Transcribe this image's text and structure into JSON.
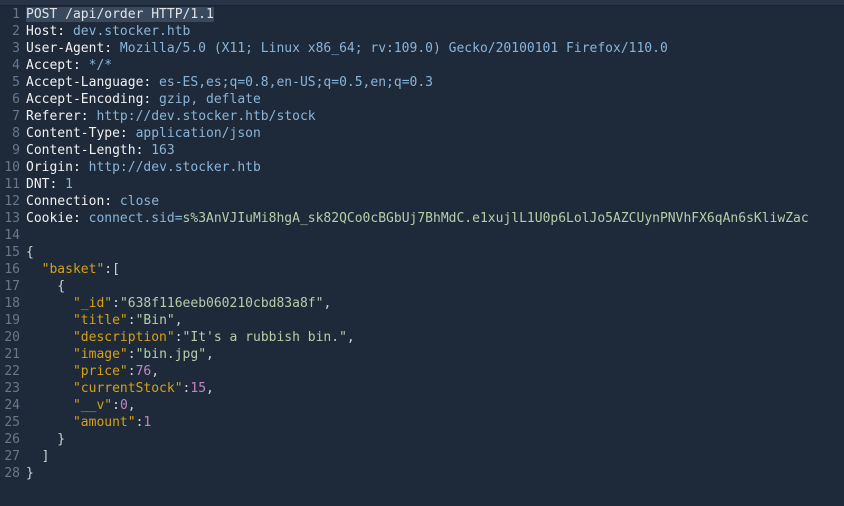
{
  "lines": [
    {
      "n": 1,
      "segs": [
        {
          "t": "POST /api/order HTTP/1.1",
          "c": "sel"
        }
      ]
    },
    {
      "n": 2,
      "segs": [
        {
          "t": "Host:",
          "c": "hdr"
        },
        {
          "t": " dev.stocker.htb",
          "c": "val"
        }
      ]
    },
    {
      "n": 3,
      "segs": [
        {
          "t": "User-Agent:",
          "c": "hdr"
        },
        {
          "t": " Mozilla/5.0 (X11; Linux x86_64; rv:109.0) Gecko/20100101 Firefox/110.0",
          "c": "val"
        }
      ]
    },
    {
      "n": 4,
      "segs": [
        {
          "t": "Accept:",
          "c": "hdr"
        },
        {
          "t": " */*",
          "c": "val"
        }
      ]
    },
    {
      "n": 5,
      "segs": [
        {
          "t": "Accept-Language:",
          "c": "hdr"
        },
        {
          "t": " es-ES,es;q=0.8,en-US;q=0.5,en;q=0.3",
          "c": "val"
        }
      ]
    },
    {
      "n": 6,
      "segs": [
        {
          "t": "Accept-Encoding:",
          "c": "hdr"
        },
        {
          "t": " gzip, deflate",
          "c": "val"
        }
      ]
    },
    {
      "n": 7,
      "segs": [
        {
          "t": "Referer:",
          "c": "hdr"
        },
        {
          "t": " http://dev.stocker.htb/stock",
          "c": "val"
        }
      ]
    },
    {
      "n": 8,
      "segs": [
        {
          "t": "Content-Type:",
          "c": "hdr"
        },
        {
          "t": " application/json",
          "c": "val"
        }
      ]
    },
    {
      "n": 9,
      "segs": [
        {
          "t": "Content-Length:",
          "c": "hdr"
        },
        {
          "t": " 163",
          "c": "val"
        }
      ]
    },
    {
      "n": 10,
      "segs": [
        {
          "t": "Origin:",
          "c": "hdr"
        },
        {
          "t": " http://dev.stocker.htb",
          "c": "val"
        }
      ]
    },
    {
      "n": 11,
      "segs": [
        {
          "t": "DNT:",
          "c": "hdr"
        },
        {
          "t": " 1",
          "c": "val"
        }
      ]
    },
    {
      "n": 12,
      "segs": [
        {
          "t": "Connection:",
          "c": "hdr"
        },
        {
          "t": " close",
          "c": "val"
        }
      ]
    },
    {
      "n": 13,
      "segs": [
        {
          "t": "Cookie:",
          "c": "hdr"
        },
        {
          "t": " connect.sid=",
          "c": "val"
        },
        {
          "t": "s%3AnVJIuMi8hgA_sk82QCo0cBGbUj7BhMdC.e1xujlL1U0p6LolJo5AZCUynPNVhFX6qAn6sKliwZac",
          "c": "str"
        }
      ]
    },
    {
      "n": 14,
      "segs": [
        {
          "t": "",
          "c": "punct"
        }
      ]
    },
    {
      "n": 15,
      "segs": [
        {
          "t": "{",
          "c": "punct"
        }
      ]
    },
    {
      "n": 16,
      "segs": [
        {
          "t": "  ",
          "c": "punct"
        },
        {
          "t": "\"basket\"",
          "c": "key"
        },
        {
          "t": ":[",
          "c": "punct"
        }
      ]
    },
    {
      "n": 17,
      "segs": [
        {
          "t": "    {",
          "c": "punct"
        }
      ]
    },
    {
      "n": 18,
      "segs": [
        {
          "t": "      ",
          "c": "punct"
        },
        {
          "t": "\"_id\"",
          "c": "key"
        },
        {
          "t": ":",
          "c": "punct"
        },
        {
          "t": "\"638f116eeb060210cbd83a8f\"",
          "c": "str"
        },
        {
          "t": ",",
          "c": "punct"
        }
      ]
    },
    {
      "n": 19,
      "segs": [
        {
          "t": "      ",
          "c": "punct"
        },
        {
          "t": "\"title\"",
          "c": "key"
        },
        {
          "t": ":",
          "c": "punct"
        },
        {
          "t": "\"Bin\"",
          "c": "str"
        },
        {
          "t": ",",
          "c": "punct"
        }
      ]
    },
    {
      "n": 20,
      "segs": [
        {
          "t": "      ",
          "c": "punct"
        },
        {
          "t": "\"description\"",
          "c": "key"
        },
        {
          "t": ":",
          "c": "punct"
        },
        {
          "t": "\"It's a rubbish bin.\"",
          "c": "str"
        },
        {
          "t": ",",
          "c": "punct"
        }
      ]
    },
    {
      "n": 21,
      "segs": [
        {
          "t": "      ",
          "c": "punct"
        },
        {
          "t": "\"image\"",
          "c": "key"
        },
        {
          "t": ":",
          "c": "punct"
        },
        {
          "t": "\"bin.jpg\"",
          "c": "str"
        },
        {
          "t": ",",
          "c": "punct"
        }
      ]
    },
    {
      "n": 22,
      "segs": [
        {
          "t": "      ",
          "c": "punct"
        },
        {
          "t": "\"price\"",
          "c": "key"
        },
        {
          "t": ":",
          "c": "punct"
        },
        {
          "t": "76",
          "c": "num"
        },
        {
          "t": ",",
          "c": "punct"
        }
      ]
    },
    {
      "n": 23,
      "segs": [
        {
          "t": "      ",
          "c": "punct"
        },
        {
          "t": "\"currentStock\"",
          "c": "key"
        },
        {
          "t": ":",
          "c": "punct"
        },
        {
          "t": "15",
          "c": "num"
        },
        {
          "t": ",",
          "c": "punct"
        }
      ]
    },
    {
      "n": 24,
      "segs": [
        {
          "t": "      ",
          "c": "punct"
        },
        {
          "t": "\"__v\"",
          "c": "key"
        },
        {
          "t": ":",
          "c": "punct"
        },
        {
          "t": "0",
          "c": "num"
        },
        {
          "t": ",",
          "c": "punct"
        }
      ]
    },
    {
      "n": 25,
      "segs": [
        {
          "t": "      ",
          "c": "punct"
        },
        {
          "t": "\"amount\"",
          "c": "key"
        },
        {
          "t": ":",
          "c": "punct"
        },
        {
          "t": "1",
          "c": "num"
        }
      ]
    },
    {
      "n": 26,
      "segs": [
        {
          "t": "    }",
          "c": "punct"
        }
      ]
    },
    {
      "n": 27,
      "segs": [
        {
          "t": "  ]",
          "c": "punct"
        }
      ]
    },
    {
      "n": 28,
      "segs": [
        {
          "t": "}",
          "c": "punct"
        }
      ]
    }
  ]
}
